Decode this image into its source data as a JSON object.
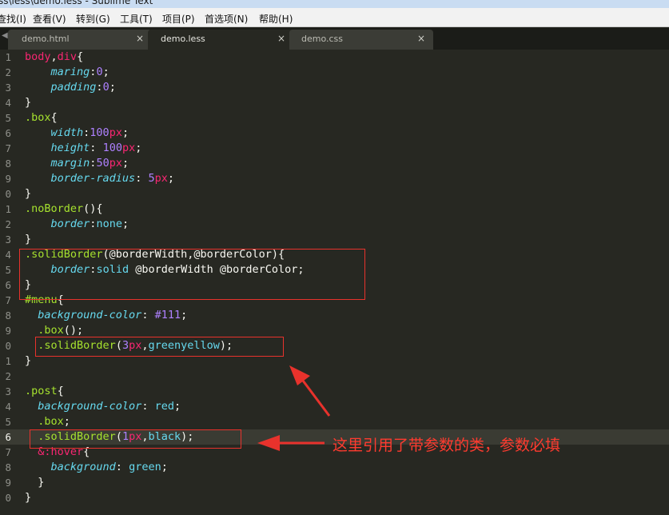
{
  "window": {
    "title": "ss\\less\\demo.less - Sublime Text"
  },
  "menu": [
    "查找(I)",
    "查看(V)",
    "转到(G)",
    "工具(T)",
    "项目(P)",
    "首选项(N)",
    "帮助(H)"
  ],
  "tabs": [
    {
      "label": "demo.html",
      "close": "×"
    },
    {
      "label": "demo.less",
      "close": "×"
    },
    {
      "label": "demo.css",
      "close": "×"
    }
  ],
  "tab_scroll_arrow": "◀",
  "line_numbers": [
    "1",
    "2",
    "3",
    "4",
    "5",
    "6",
    "7",
    "8",
    "9",
    "0",
    "1",
    "2",
    "3",
    "4",
    "5",
    "6",
    "7",
    "8",
    "9",
    "0",
    "1",
    "2",
    "3",
    "4",
    "5",
    "6",
    "7",
    "8",
    "9",
    "0"
  ],
  "code": [
    {
      "tokens": [
        [
          "sel",
          "body"
        ],
        [
          "txt",
          ","
        ],
        [
          "sel",
          "div"
        ],
        [
          "txt",
          "{"
        ]
      ]
    },
    {
      "tokens": [
        [
          "txt",
          "    "
        ],
        [
          "prop",
          "maring"
        ],
        [
          "txt",
          ":"
        ],
        [
          "num",
          "0"
        ],
        [
          "txt",
          ";"
        ]
      ]
    },
    {
      "tokens": [
        [
          "txt",
          "    "
        ],
        [
          "prop",
          "padding"
        ],
        [
          "txt",
          ":"
        ],
        [
          "num",
          "0"
        ],
        [
          "txt",
          ";"
        ]
      ]
    },
    {
      "tokens": [
        [
          "txt",
          "}"
        ]
      ]
    },
    {
      "tokens": [
        [
          "cls",
          ".box"
        ],
        [
          "txt",
          "{"
        ]
      ]
    },
    {
      "tokens": [
        [
          "txt",
          "    "
        ],
        [
          "prop",
          "width"
        ],
        [
          "txt",
          ":"
        ],
        [
          "num",
          "100"
        ],
        [
          "unit",
          "px"
        ],
        [
          "txt",
          ";"
        ]
      ]
    },
    {
      "tokens": [
        [
          "txt",
          "    "
        ],
        [
          "prop",
          "height"
        ],
        [
          "txt",
          ": "
        ],
        [
          "num",
          "100"
        ],
        [
          "unit",
          "px"
        ],
        [
          "txt",
          ";"
        ]
      ]
    },
    {
      "tokens": [
        [
          "txt",
          "    "
        ],
        [
          "prop",
          "margin"
        ],
        [
          "txt",
          ":"
        ],
        [
          "num",
          "50"
        ],
        [
          "unit",
          "px"
        ],
        [
          "txt",
          ";"
        ]
      ]
    },
    {
      "tokens": [
        [
          "txt",
          "    "
        ],
        [
          "prop",
          "border-radius"
        ],
        [
          "txt",
          ": "
        ],
        [
          "num",
          "5"
        ],
        [
          "unit",
          "px"
        ],
        [
          "txt",
          ";"
        ]
      ]
    },
    {
      "tokens": [
        [
          "txt",
          "}"
        ]
      ]
    },
    {
      "tokens": [
        [
          "cls",
          ".noBorder"
        ],
        [
          "txt",
          "(){"
        ]
      ]
    },
    {
      "tokens": [
        [
          "txt",
          "    "
        ],
        [
          "prop",
          "border"
        ],
        [
          "txt",
          ":"
        ],
        [
          "kw",
          "none"
        ],
        [
          "txt",
          ";"
        ]
      ]
    },
    {
      "tokens": [
        [
          "txt",
          "}"
        ]
      ]
    },
    {
      "tokens": [
        [
          "cls",
          ".solidBorder"
        ],
        [
          "txt",
          "(@borderWidth,@borderColor){"
        ]
      ]
    },
    {
      "tokens": [
        [
          "txt",
          "    "
        ],
        [
          "prop",
          "border"
        ],
        [
          "txt",
          ":"
        ],
        [
          "kw",
          "solid"
        ],
        [
          "txt",
          " @borderWidth @borderColor;"
        ]
      ]
    },
    {
      "tokens": [
        [
          "txt",
          "}"
        ]
      ]
    },
    {
      "tokens": [
        [
          "cls",
          "#menu"
        ],
        [
          "txt",
          "{"
        ]
      ]
    },
    {
      "tokens": [
        [
          "txt",
          "  "
        ],
        [
          "prop",
          "background-color"
        ],
        [
          "txt",
          ": "
        ],
        [
          "num",
          "#111"
        ],
        [
          "txt",
          ";"
        ]
      ]
    },
    {
      "tokens": [
        [
          "txt",
          "  "
        ],
        [
          "cls",
          ".box"
        ],
        [
          "txt",
          "();"
        ]
      ]
    },
    {
      "tokens": [
        [
          "txt",
          "  "
        ],
        [
          "cls",
          ".solidBorder"
        ],
        [
          "txt",
          "("
        ],
        [
          "num",
          "3"
        ],
        [
          "unit",
          "px"
        ],
        [
          "txt",
          ","
        ],
        [
          "kw",
          "greenyellow"
        ],
        [
          "txt",
          ");"
        ]
      ]
    },
    {
      "tokens": [
        [
          "txt",
          "}"
        ]
      ]
    },
    {
      "tokens": [
        [
          "txt",
          ""
        ]
      ]
    },
    {
      "tokens": [
        [
          "cls",
          ".post"
        ],
        [
          "txt",
          "{"
        ]
      ]
    },
    {
      "tokens": [
        [
          "txt",
          "  "
        ],
        [
          "prop",
          "background-color"
        ],
        [
          "txt",
          ": "
        ],
        [
          "kw",
          "red"
        ],
        [
          "txt",
          ";"
        ]
      ]
    },
    {
      "tokens": [
        [
          "txt",
          "  "
        ],
        [
          "cls",
          ".box"
        ],
        [
          "txt",
          ";"
        ]
      ]
    },
    {
      "tokens": [
        [
          "txt",
          "  "
        ],
        [
          "cls",
          ".solidBorder"
        ],
        [
          "txt",
          "("
        ],
        [
          "num",
          "1"
        ],
        [
          "unit",
          "px"
        ],
        [
          "txt",
          ","
        ],
        [
          "kw",
          "black"
        ],
        [
          "txt",
          ");"
        ]
      ]
    },
    {
      "tokens": [
        [
          "txt",
          "  "
        ],
        [
          "sel",
          "&:hover"
        ],
        [
          "txt",
          "{"
        ]
      ]
    },
    {
      "tokens": [
        [
          "txt",
          "    "
        ],
        [
          "prop",
          "background"
        ],
        [
          "txt",
          ": "
        ],
        [
          "kw",
          "green"
        ],
        [
          "txt",
          ";"
        ]
      ]
    },
    {
      "tokens": [
        [
          "txt",
          "  }"
        ]
      ]
    },
    {
      "tokens": [
        [
          "txt",
          "}"
        ]
      ]
    }
  ],
  "annotation": "这里引用了带参数的类，参数必填",
  "colors": {
    "editor_bg": "#272822",
    "annotation": "#e8322c"
  }
}
